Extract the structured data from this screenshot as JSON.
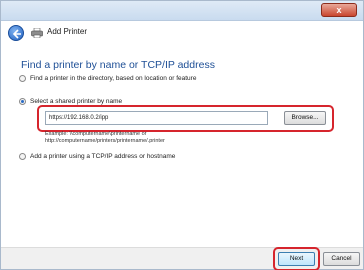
{
  "window": {
    "close_label": "x"
  },
  "nav": {
    "title": "Add Printer"
  },
  "main": {
    "heading": "Find a printer by name or TCP/IP address",
    "options": [
      {
        "label": "Find a printer in the directory, based on location or feature",
        "checked": false
      },
      {
        "label": "Select a shared printer by name",
        "checked": true
      },
      {
        "label": "Add a printer using a TCP/IP address or hostname",
        "checked": false
      }
    ],
    "url_value": "https://192.168.0.2/ipp",
    "browse_label": "Browse...",
    "example_line1": "Example: \\\\computername\\printername or",
    "example_line2": "http://computername/printers/printername/.printer"
  },
  "footer": {
    "next_label": "Next",
    "cancel_label": "Cancel"
  },
  "colors": {
    "heading": "#1e4f96",
    "highlight": "#d6252d"
  }
}
